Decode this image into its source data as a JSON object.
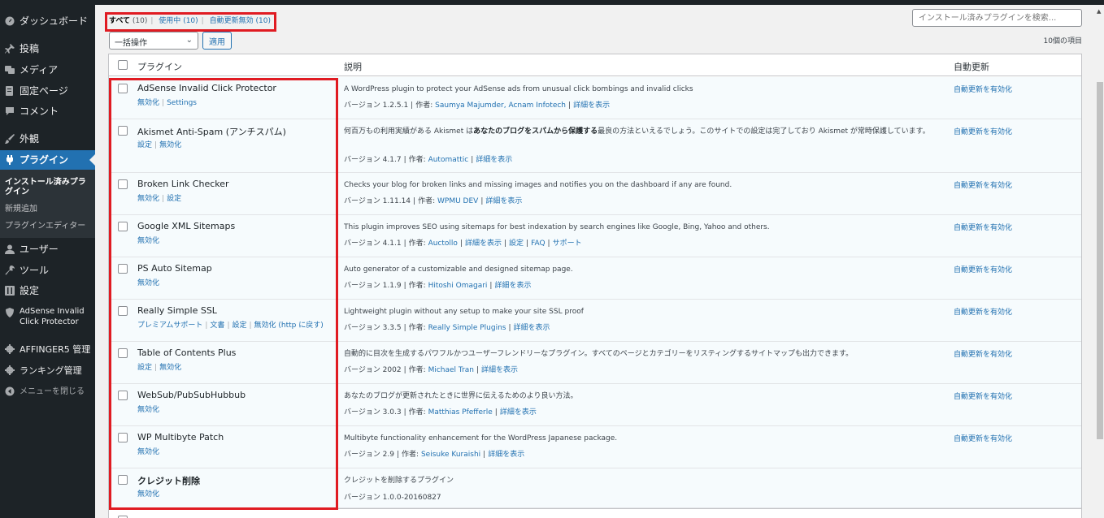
{
  "sidebar": {
    "items": [
      {
        "label": "ダッシュボード",
        "icon": "dashboard-icon"
      },
      {
        "label": "投稿",
        "icon": "pin-icon"
      },
      {
        "label": "メディア",
        "icon": "media-icon"
      },
      {
        "label": "固定ページ",
        "icon": "page-icon"
      },
      {
        "label": "コメント",
        "icon": "comment-icon"
      },
      {
        "label": "外観",
        "icon": "brush-icon"
      },
      {
        "label": "プラグイン",
        "icon": "plugin-icon"
      },
      {
        "label": "ユーザー",
        "icon": "user-icon"
      },
      {
        "label": "ツール",
        "icon": "wrench-icon"
      },
      {
        "label": "設定",
        "icon": "settings-icon"
      },
      {
        "label": "AdSense Invalid Click Protector",
        "icon": "shield-icon"
      },
      {
        "label": "AFFINGER5 管理",
        "icon": "gear-icon"
      },
      {
        "label": "ランキング管理",
        "icon": "gear-icon"
      },
      {
        "label": "メニューを閉じる",
        "icon": "collapse-icon"
      }
    ],
    "submenu": [
      "インストール済みプラグイン",
      "新規追加",
      "プラグインエディター"
    ]
  },
  "filters": {
    "all": "すべて",
    "all_count": "(10)",
    "active": "使用中",
    "active_count": "(10)",
    "auto_off": "自動更新無効",
    "auto_off_count": "(10)"
  },
  "search": {
    "placeholder": "インストール済みプラグインを検索..."
  },
  "bulk": {
    "selected": "一括操作",
    "apply": "適用"
  },
  "item_count": "10個の項目",
  "table": {
    "headers": {
      "plugin": "プラグイン",
      "description": "説明",
      "auto_update": "自動更新"
    },
    "rows": [
      {
        "name": "AdSense Invalid Click Protector",
        "actions": [
          "無効化",
          "Settings"
        ],
        "desc": "A WordPress plugin to protect your AdSense ads from unusual click bombings and invalid clicks",
        "version": "バージョン 1.2.5.1",
        "author_label": "作者:",
        "author": "Saumya Majumder, Acnam Infotech",
        "links": [
          "詳細を表示"
        ],
        "auto": "自動更新を有効化"
      },
      {
        "name": "Akismet Anti-Spam (アンチスパム)",
        "actions": [
          "設定",
          "無効化"
        ],
        "desc_pre": "何百万もの利用実績がある Akismet は",
        "desc_bold": "あなたのブログをスパムから保護する",
        "desc_post": "最良の方法といえるでしょう。このサイトでの設定は完了しており Akismet が常時保護しています。",
        "version": "バージョン 4.1.7",
        "author_label": "作者:",
        "author": "Automattic",
        "links": [
          "詳細を表示"
        ],
        "auto": "自動更新を有効化"
      },
      {
        "name": "Broken Link Checker",
        "actions": [
          "無効化",
          "設定"
        ],
        "desc": "Checks your blog for broken links and missing images and notifies you on the dashboard if any are found.",
        "version": "バージョン 1.11.14",
        "author_label": "作者:",
        "author": "WPMU DEV",
        "links": [
          "詳細を表示"
        ],
        "auto": "自動更新を有効化"
      },
      {
        "name": "Google XML Sitemaps",
        "actions": [
          "無効化"
        ],
        "desc": "This plugin improves SEO using sitemaps for best indexation by search engines like Google, Bing, Yahoo and others.",
        "version": "バージョン 4.1.1",
        "author_label": "作者:",
        "author": "Auctollo",
        "links": [
          "詳細を表示",
          "設定",
          "FAQ",
          "サポート"
        ],
        "auto": "自動更新を有効化"
      },
      {
        "name": "PS Auto Sitemap",
        "actions": [
          "無効化"
        ],
        "desc": "Auto generator of a customizable and designed sitemap page.",
        "version": "バージョン 1.1.9",
        "author_label": "作者:",
        "author": "Hitoshi Omagari",
        "links": [
          "詳細を表示"
        ],
        "auto": "自動更新を有効化"
      },
      {
        "name": "Really Simple SSL",
        "actions": [
          "プレミアムサポート",
          "文書",
          "設定",
          "無効化 (http に戻す)"
        ],
        "desc": "Lightweight plugin without any setup to make your site SSL proof",
        "version": "バージョン 3.3.5",
        "author_label": "作者:",
        "author": "Really Simple Plugins",
        "links": [
          "詳細を表示"
        ],
        "auto": "自動更新を有効化"
      },
      {
        "name": "Table of Contents Plus",
        "actions": [
          "設定",
          "無効化"
        ],
        "desc": "自動的に目次を生成するパワフルかつユーザーフレンドリーなプラグイン。すべてのページとカテゴリーをリスティングするサイトマップも出力できます。",
        "version": "バージョン 2002",
        "author_label": "作者:",
        "author": "Michael Tran",
        "links": [
          "詳細を表示"
        ],
        "auto": "自動更新を有効化"
      },
      {
        "name": "WebSub/PubSubHubbub",
        "actions": [
          "無効化"
        ],
        "desc": "あなたのブログが更新されたときに世界に伝えるためのより良い方法。",
        "version": "バージョン 3.0.3",
        "author_label": "作者:",
        "author": "Matthias Pfefferle",
        "links": [
          "詳細を表示"
        ],
        "auto": "自動更新を有効化"
      },
      {
        "name": "WP Multibyte Patch",
        "actions": [
          "無効化"
        ],
        "desc": "Multibyte functionality enhancement for the WordPress Japanese package.",
        "version": "バージョン 2.9",
        "author_label": "作者:",
        "author": "Seisuke Kuraishi",
        "links": [
          "詳細を表示"
        ],
        "auto": "自動更新を有効化"
      },
      {
        "name": "クレジット削除",
        "actions": [
          "無効化"
        ],
        "desc": "クレジットを削除するプラグイン",
        "version": "バージョン 1.0.0-20160827",
        "auto": ""
      }
    ]
  },
  "colors": {
    "highlight": "#e01b22",
    "accent": "#2271b1",
    "sidebar": "#1d2327"
  }
}
